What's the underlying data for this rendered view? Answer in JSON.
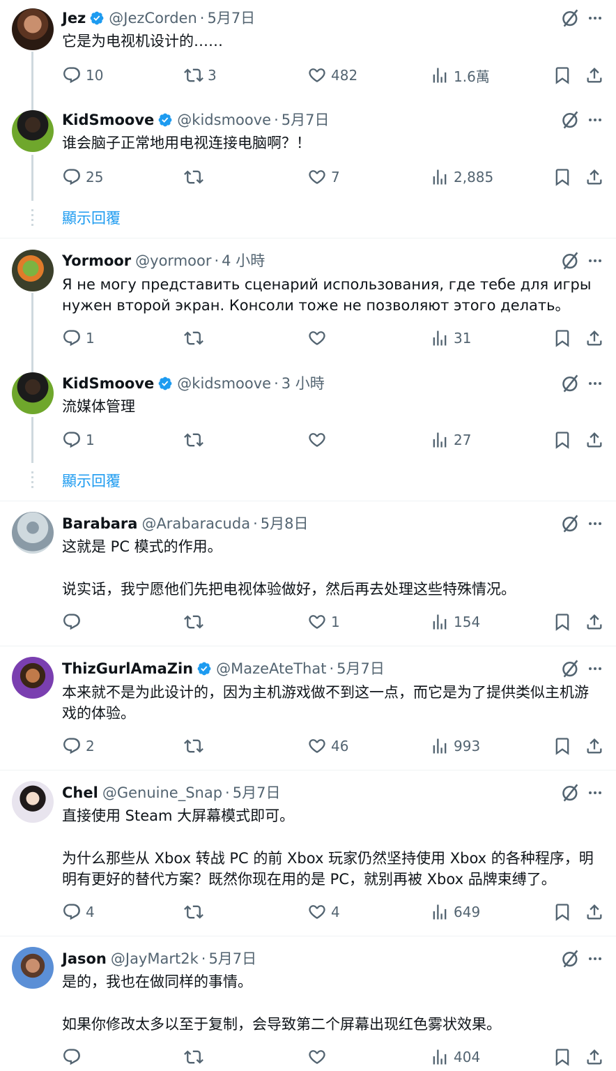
{
  "labels": {
    "show_replies": "顯示回覆"
  },
  "colors": {
    "accent": "#1d9bf0",
    "muted": "#536471",
    "text": "#0f1419"
  },
  "tweets": [
    {
      "name": "Jez",
      "verified": true,
      "handle": "@JezCorden",
      "time": "5月7日",
      "text": [
        "它是为电视机设计的……"
      ],
      "replies": "10",
      "retweets": "3",
      "likes": "482",
      "views": "1.6萬"
    },
    {
      "name": "KidSmoove",
      "verified": true,
      "handle": "@kidsmoove",
      "time": "5月7日",
      "text": [
        "谁会脑子正常地用电视连接电脑啊？！"
      ],
      "replies": "25",
      "retweets": "",
      "likes": "7",
      "views": "2,885"
    },
    {
      "name": "Yormoor",
      "verified": false,
      "handle": "@yormoor",
      "time": "4 小時",
      "text": [
        "Я не могу представить сценарий использования, где тебе для игры нужен второй экран. Консоли тоже не позволяют этого делать。"
      ],
      "replies": "1",
      "retweets": "",
      "likes": "",
      "views": "31"
    },
    {
      "name": "KidSmoove",
      "verified": true,
      "handle": "@kidsmoove",
      "time": "3 小時",
      "text": [
        "流媒体管理"
      ],
      "replies": "1",
      "retweets": "",
      "likes": "",
      "views": "27"
    },
    {
      "name": "Barabara",
      "verified": false,
      "handle": "@Arabaracuda",
      "time": "5月8日",
      "text": [
        "这就是 PC 模式的作用。",
        "说实话，我宁愿他们先把电视体验做好，然后再去处理这些特殊情况。"
      ],
      "replies": "",
      "retweets": "",
      "likes": "1",
      "views": "154"
    },
    {
      "name": "ThizGurlAmaZin",
      "verified": true,
      "handle": "@MazeAteThat",
      "time": "5月7日",
      "text": [
        "本来就不是为此设计的，因为主机游戏做不到这一点，而它是为了提供类似主机游戏的体验。"
      ],
      "replies": "2",
      "retweets": "",
      "likes": "46",
      "views": "993"
    },
    {
      "name": "Chel",
      "verified": false,
      "handle": "@Genuine_Snap",
      "time": "5月7日",
      "text": [
        "直接使用 Steam 大屏幕模式即可。",
        "为什么那些从 Xbox 转战 PC 的前 Xbox 玩家仍然坚持使用 Xbox 的各种程序，明明有更好的替代方案？既然你现在用的是 PC，就别再被 Xbox 品牌束缚了。"
      ],
      "replies": "4",
      "retweets": "",
      "likes": "4",
      "views": "649"
    },
    {
      "name": "Jason",
      "verified": false,
      "handle": "@JayMart2k",
      "time": "5月7日",
      "text": [
        "是的，我也在做同样的事情。",
        "如果你修改太多以至于复制，会导致第二个屏幕出现红色雾状效果。"
      ],
      "replies": "",
      "retweets": "",
      "likes": "",
      "views": "404"
    }
  ]
}
